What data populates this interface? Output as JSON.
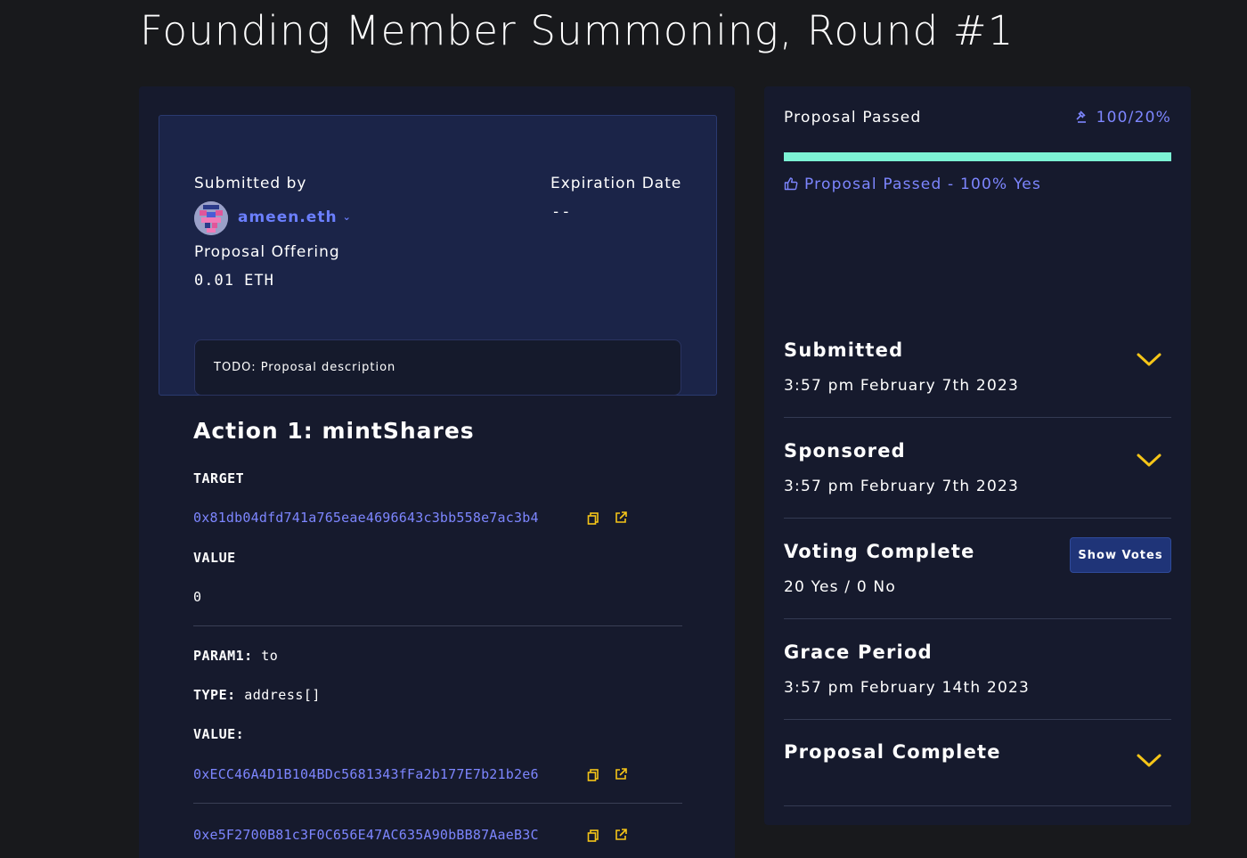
{
  "page": {
    "title": "Founding Member Summoning, Round #1"
  },
  "header": {
    "submitted_by_label": "Submitted by",
    "submitter": "ameen.eth",
    "expiration_label": "Expiration Date",
    "expiration_value": "--",
    "offering_label": "Proposal Offering",
    "offering_value": "0.01 ETH",
    "description": "TODO: Proposal description"
  },
  "action": {
    "title": "Action 1: mintShares",
    "target_label": "TARGET",
    "target_address": "0x81db04dfd741a765eae4696643c3bb558e7ac3b4",
    "value_label": "VALUE",
    "value": "0",
    "param1_label": "PARAM1:",
    "param1_name": "to",
    "type_label": "TYPE:",
    "type_value": "address[]",
    "param_value_label": "VALUE:",
    "param_values": [
      "0xECC46A4D1B104BDc5681343fFa2b177E7b21b2e6",
      "0xe5F2700B81c3F0C656E47AC635A90bBB87AaeB3C"
    ]
  },
  "status": {
    "label": "Proposal Passed",
    "quorum": "100/20%",
    "progress_percent": 100,
    "result": "Proposal Passed - 100% Yes",
    "bar_color": "#7cf2d4",
    "accent_color": "#7d86ff"
  },
  "timeline": {
    "submitted_title": "Submitted",
    "submitted_date": "3:57 pm February 7th 2023",
    "sponsored_title": "Sponsored",
    "sponsored_date": "3:57 pm February 7th 2023",
    "voting_title": "Voting Complete",
    "voting_result": "20 Yes / 0 No",
    "show_votes_label": "Show Votes",
    "grace_title": "Grace Period",
    "grace_date": "3:57 pm February 14th 2023",
    "complete_title": "Proposal Complete"
  },
  "icons": {
    "copy": "copy-icon",
    "external": "external-link-icon",
    "chevron": "chevron-down-icon",
    "thumbs_up": "thumbs-up-icon",
    "gavel": "gavel-icon"
  }
}
